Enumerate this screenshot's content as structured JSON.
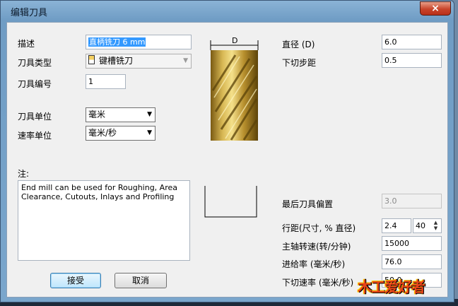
{
  "window": {
    "title": "编辑刀具",
    "close_glyph": "×"
  },
  "form": {
    "description_label": "描述",
    "description_value": "直柄铣刀 6 mm",
    "tool_type_label": "刀具类型",
    "tool_type_value": "键槽铣刀",
    "tool_number_label": "刀具编号",
    "tool_number_value": "1",
    "tool_units_label": "刀具单位",
    "tool_units_value": "毫米",
    "rate_units_label": "速率单位",
    "rate_units_value": "毫米/秒",
    "notes_label": "注:",
    "notes_value": "End mill can be used for Roughing, Area\nClearance, Cutouts, Inlays and Profiling"
  },
  "diagram": {
    "dimension_label": "D"
  },
  "params": {
    "diameter_label": "直径 (D)",
    "diameter_value": "6.0",
    "stepdown_label": "下切步距",
    "stepdown_value": "0.5",
    "last_offset_label": "最后刀具偏置",
    "last_offset_value": "3.0",
    "stepover_label": "行距(尺寸, % 直径)",
    "stepover_value": "2.4",
    "stepover_percent": "40",
    "spindle_label": "主轴转速(转/分钟)",
    "spindle_value": "15000",
    "feed_label": "进给率 (毫米/秒)",
    "feed_value": "76.0",
    "plunge_label": "下切速率 (毫米/秒)",
    "plunge_value": "50.0"
  },
  "buttons": {
    "accept": "接受",
    "cancel": "取消"
  },
  "watermark": {
    "text": "木工爱好者"
  },
  "icons": {
    "combo_arrow": "▼",
    "spin_up": "▲",
    "spin_down": "▼",
    "tool_type": "end-mill-icon"
  },
  "colors": {
    "selection": "#3399ff",
    "title_bar": "#7aa6cc",
    "close_button": "#c8442a",
    "tool_gold": "#c9a43a"
  }
}
